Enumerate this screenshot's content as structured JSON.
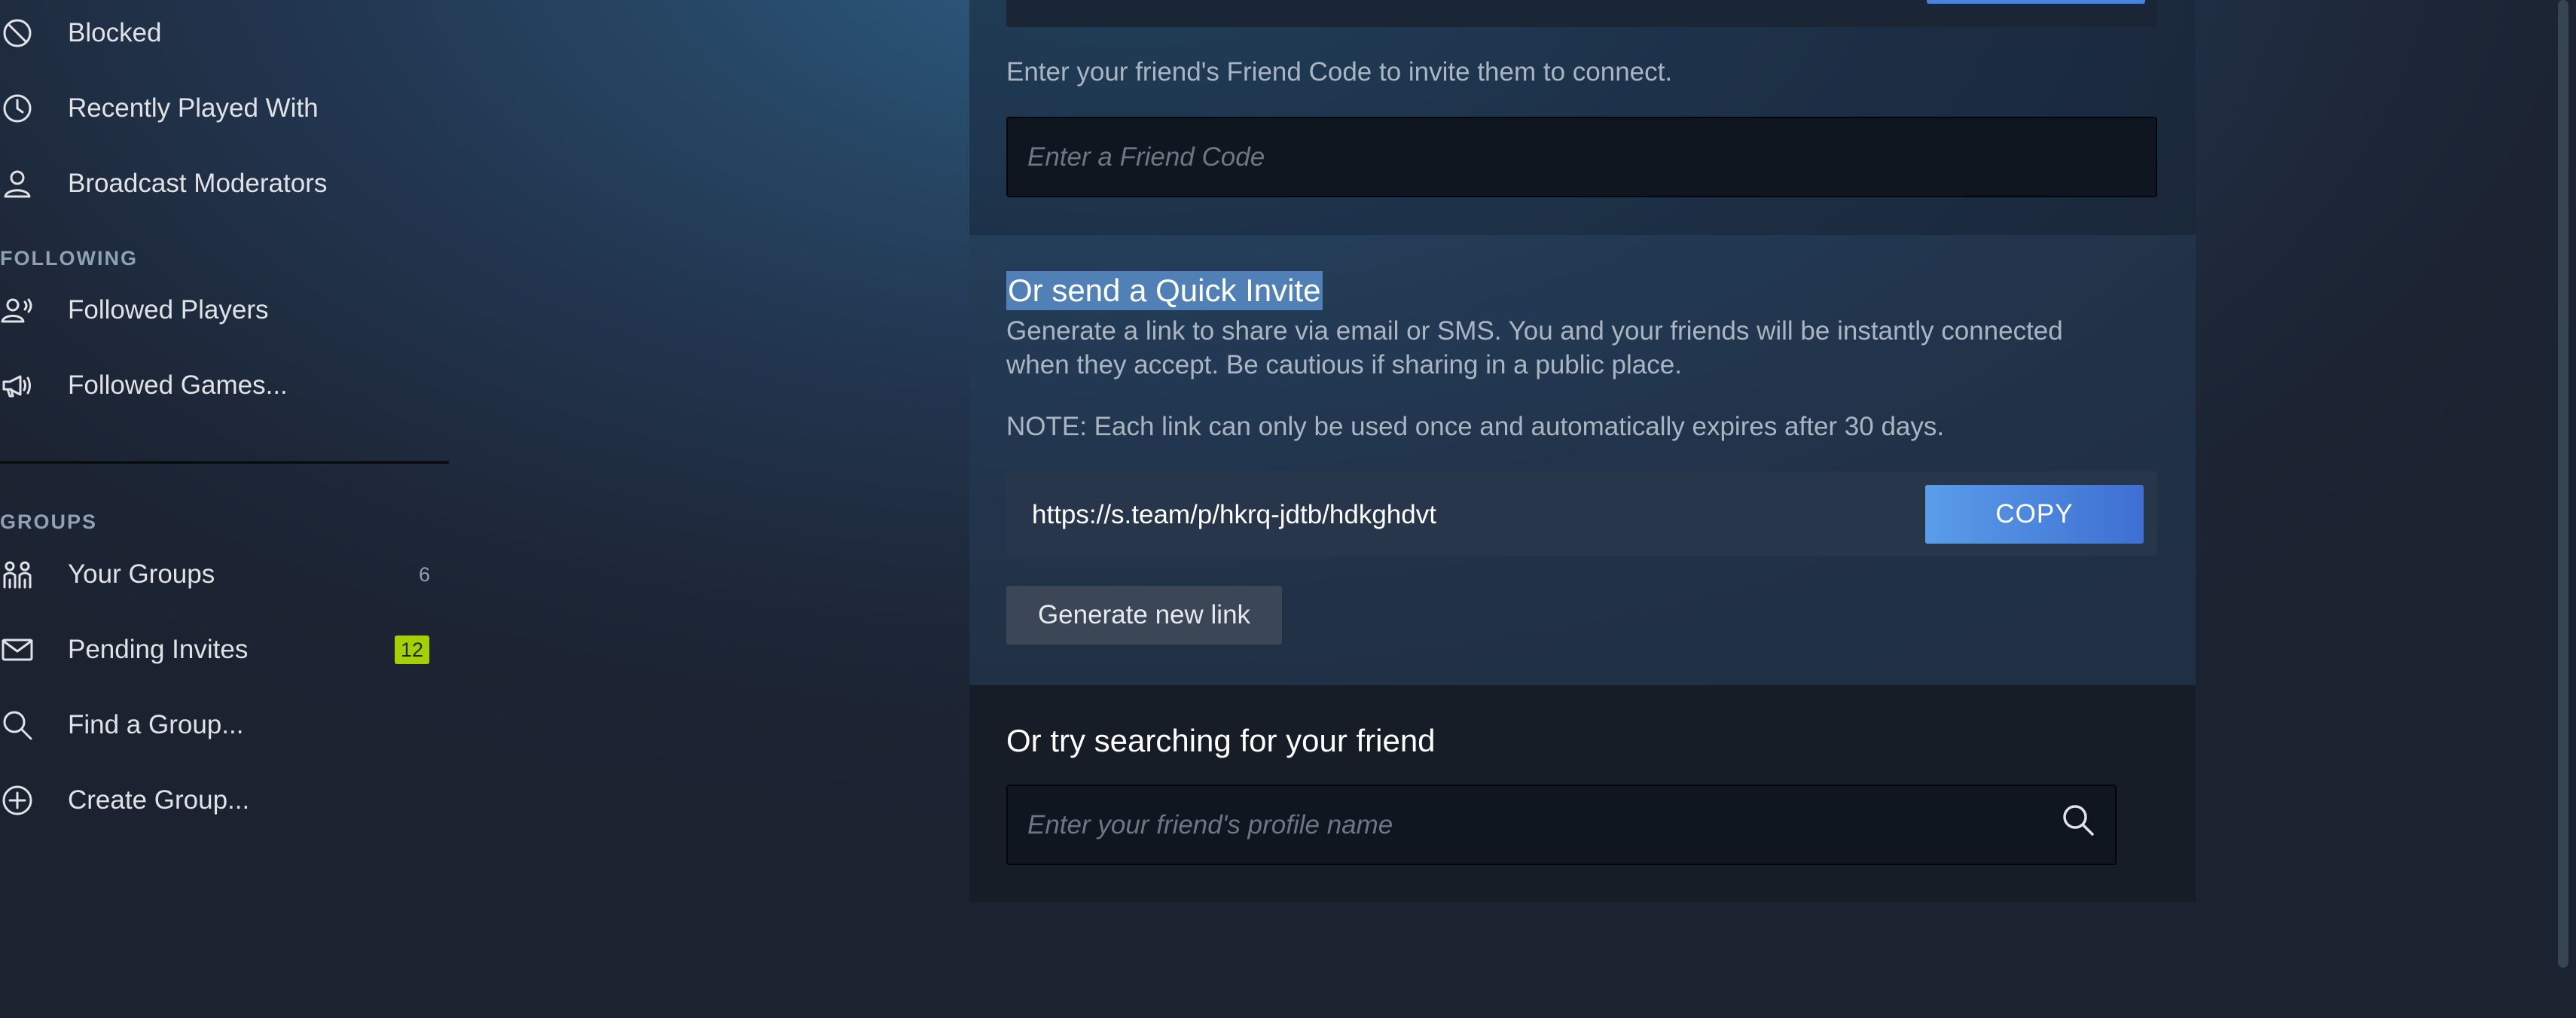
{
  "sidebar": {
    "items_top": [
      {
        "label": "Blocked",
        "icon": "blocked-icon"
      },
      {
        "label": "Recently Played With",
        "icon": "clock-icon"
      },
      {
        "label": "Broadcast Moderators",
        "icon": "person-icon"
      }
    ],
    "following_title": "FOLLOWING",
    "following_items": [
      {
        "label": "Followed Players",
        "icon": "followed-player-icon"
      },
      {
        "label": "Followed Games...",
        "icon": "megaphone-icon"
      }
    ],
    "groups_title": "GROUPS",
    "group_items": [
      {
        "label": "Your Groups",
        "icon": "groups-icon",
        "count": "6"
      },
      {
        "label": "Pending Invites",
        "icon": "envelope-icon",
        "badge": "12"
      },
      {
        "label": "Find a Group...",
        "icon": "search-icon"
      },
      {
        "label": "Create Group...",
        "icon": "plus-circle-icon"
      }
    ]
  },
  "friend_code": {
    "instruction": "Enter your friend's Friend Code to invite them to connect.",
    "placeholder": "Enter a Friend Code"
  },
  "quick_invite": {
    "title": "Or send a Quick Invite",
    "description_line1": "Generate a link to share via email or SMS. You and your friends will be instantly connected",
    "description_line2": "when they accept. Be cautious if sharing in a public place.",
    "note": "NOTE: Each link can only be used once and automatically expires after 30 days.",
    "link": "https://s.team/p/hkrq-jdtb/hdkghdvt",
    "copy_label": "COPY",
    "generate_label": "Generate new link"
  },
  "search": {
    "title": "Or try searching for your friend",
    "placeholder": "Enter your friend's profile name"
  },
  "colors": {
    "accent_blue": "#4a84d8",
    "badge_green": "#a4d007",
    "selection": "#5180b7"
  }
}
